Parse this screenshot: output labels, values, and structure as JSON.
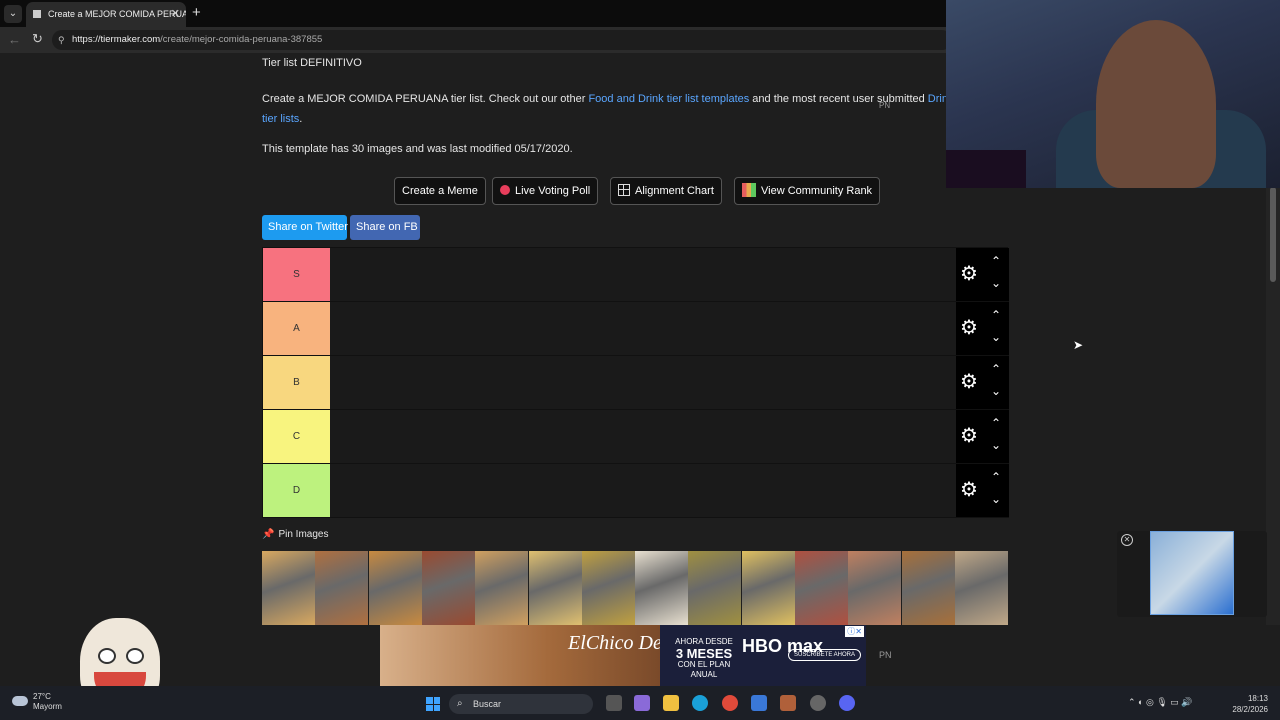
{
  "browser": {
    "tab_title": "Create a MEJOR COMIDA PERUANA",
    "tab_close": "✕",
    "new_tab": "+",
    "url_domain": "https://tiermaker.com",
    "url_path": "/create/mejor-comida-peruana-387855"
  },
  "page": {
    "subtitle": "Tier list DEFINITIVO",
    "desc_part1": "Create a MEJOR COMIDA PERUANA tier list. Check out our other ",
    "desc_link1": "Food and Drink tier list templates",
    "desc_part2": " and the most recent user submitted ",
    "desc_link2": "Drink tier lists",
    "desc_part3": ".",
    "overlay_pn": "PN",
    "info": "This template has 30 images and was last modified 05/17/2020.",
    "buttons": {
      "meme": "Create a Meme",
      "poll": "Live Voting Poll",
      "alignment": "Alignment Chart",
      "community": "View Community Rank"
    },
    "share": {
      "twitter": "Share on Twitter",
      "fb": "Share on FB"
    },
    "tiers": [
      {
        "label": "S",
        "color": "#f7727f"
      },
      {
        "label": "A",
        "color": "#f8b37e"
      },
      {
        "label": "B",
        "color": "#f8d77f"
      },
      {
        "label": "C",
        "color": "#f8f47f"
      },
      {
        "label": "D",
        "color": "#bdf27e"
      }
    ],
    "pin_images": "Pin Images",
    "food_colors": [
      "#d8a860",
      "#b07040",
      "#c88a40",
      "#9a4a30",
      "#d0a060",
      "#e0c070",
      "#c0a040",
      "#e8e0d0",
      "#a09040",
      "#e0c060",
      "#b05040",
      "#c08060",
      "#a8703a",
      "#c0a888"
    ]
  },
  "ad": {
    "brand": "ElChico DeOro",
    "promo_small": "AHORA DESDE",
    "promo_big": "3 MESES",
    "promo_sub": "CON EL PLAN ANUAL",
    "logo": "HBO max",
    "cta": "SUSCRÍBETE AHORA",
    "pn": "PN"
  },
  "taskbar": {
    "temp": "27°C",
    "weather": "Mayorm",
    "search": "Buscar",
    "time": "18:13",
    "date": "28/2/2026"
  }
}
